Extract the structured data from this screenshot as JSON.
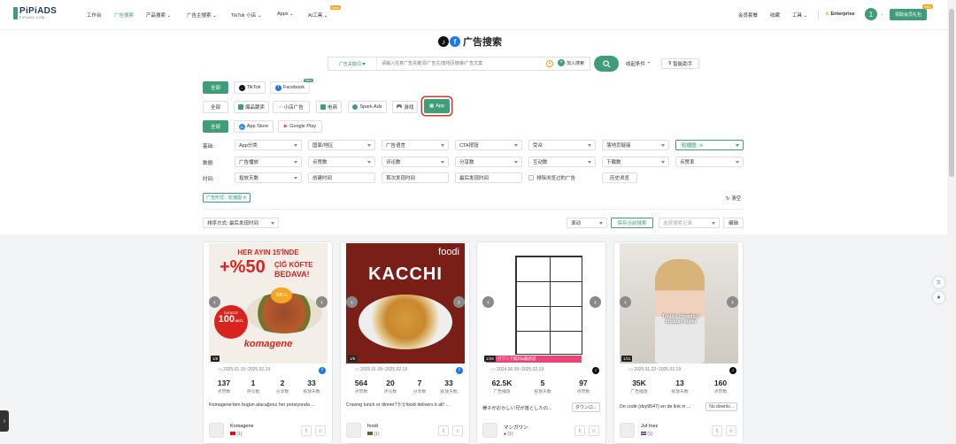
{
  "brand": {
    "name": "PiPiADS",
    "sub": "PIPIADS.COM"
  },
  "nav": {
    "items": [
      "工作台",
      "广告搜索",
      "产品搜索",
      "广告主搜索",
      "TikTok 小店",
      "Apps",
      "AI工具"
    ],
    "new_badge": "New",
    "right": [
      "会员套餐",
      "收藏",
      "工具"
    ],
    "plan": "Enterprise",
    "avatar": "1",
    "upgrade": "领取会员礼包",
    "upgrade_badge": "New"
  },
  "page_title": "广告搜索",
  "search": {
    "type_label": "广告关键词",
    "placeholder": "请输入任意广告关键词/广告主/落地页链接/广告文案",
    "add_label": "加入搜索",
    "collapse_label": "收起条件",
    "ai_label": "智能助手"
  },
  "platforms": {
    "all": "全部",
    "items": [
      "TikTok",
      "Facebook"
    ],
    "new_badge": "New"
  },
  "ad_types": {
    "all": "全部",
    "items": [
      "爆品跟卖",
      "小店广告",
      "电商",
      "Spark Ads",
      "游戏",
      "App"
    ]
  },
  "stores": {
    "all": "全部",
    "items": [
      "App Store",
      "Google Play"
    ]
  },
  "filters": {
    "basic_label": "基础:",
    "basic": [
      "App分类",
      "国家/地区",
      "广告语言",
      "CTA按钮",
      "受众",
      "落地页链接"
    ],
    "basic_extra": "轮播图",
    "data_label": "数据:",
    "data": [
      "广告播放",
      "点赞数",
      "评论数",
      "分享数",
      "互动数",
      "下载数",
      "点赞率"
    ],
    "time_label": "时间:",
    "time": [
      "投放天数",
      "创建时间",
      "首次发现时间",
      "最后发现时间"
    ],
    "exclude_label": "排除浏览过的广告",
    "history_label": "历史浏览"
  },
  "active_tag": "广告形式：轮播图",
  "clear_label": "清空",
  "sort": {
    "label": "排序方式: 最后发现时间",
    "scroll": "滚动",
    "save": "保存当前搜索",
    "saved_placeholder": "选择搜索记录",
    "edit": "编辑"
  },
  "cards": [
    {
      "date": "2025.01.15~2025.02.19",
      "stats": [
        {
          "v": "137",
          "l": "点赞数"
        },
        {
          "v": "1",
          "l": "评论数"
        },
        {
          "v": "2",
          "l": "分享数"
        },
        {
          "v": "33",
          "l": "投放天数"
        }
      ],
      "desc": "Komagene'den bugün alacağınız her porsiyonda ...",
      "cta": "",
      "name": "Komagene",
      "sub": "(1)",
      "page": "1/6",
      "platform": "facebook"
    },
    {
      "date": "2025.01.09~2025.02.19",
      "stats": [
        {
          "v": "564",
          "l": "点赞数"
        },
        {
          "v": "20",
          "l": "评论数"
        },
        {
          "v": "7",
          "l": "分享数"
        },
        {
          "v": "33",
          "l": "投放天数"
        }
      ],
      "desc": "Craving lunch or dinner? 🍽 foodi delivers it all! ...",
      "cta": "",
      "name": "foodi",
      "sub": "(1)",
      "page": "1/8",
      "platform": "facebook"
    },
    {
      "date": "2024.06.09~2025.02.19",
      "stats": [
        {
          "v": "62.5K",
          "l": "广告播放"
        },
        {
          "v": "5",
          "l": "投放天数"
        },
        {
          "v": "97",
          "l": "点赞数"
        }
      ],
      "desc": "様子がおかしい兄が落としたの...",
      "cta": "ダウンロ...",
      "name": "マンガワン",
      "sub": "(1)",
      "page": "1/29",
      "platform": "tiktok"
    },
    {
      "date": "2025.01.22~2025.02.19",
      "stats": [
        {
          "v": "35K",
          "l": "广告播放"
        },
        {
          "v": "13",
          "l": "投放天数"
        },
        {
          "v": "160",
          "l": "点赞数"
        }
      ],
      "desc": "De code (dsy9547) en de link in ...",
      "cta": "Nu downlo...",
      "name": "Juf Inez",
      "sub": "(1)",
      "page": "1/11",
      "platform": "tiktok"
    }
  ],
  "thumbs": {
    "c1_line1": "HER AYIN 15'İNDE",
    "c1_big": "+%50",
    "c1_line2": "ÇİĞ KÖFTE",
    "c1_line3": "BEDAVA!",
    "c1_badge": "SADECE",
    "c1_price": "100",
    "c1_unit": ".00TL",
    "c1_gram": "300 G",
    "c1_logo": "komagene",
    "c2_logo": "foodi",
    "c2_big": "KACCHI",
    "c3_banner": "マンガワンで無料&最新話",
    "c4_caption": "Tonia's cheating / dustpan outlet"
  },
  "colors": {
    "accent": "#3f9d79",
    "highlight": "#e0302a"
  }
}
